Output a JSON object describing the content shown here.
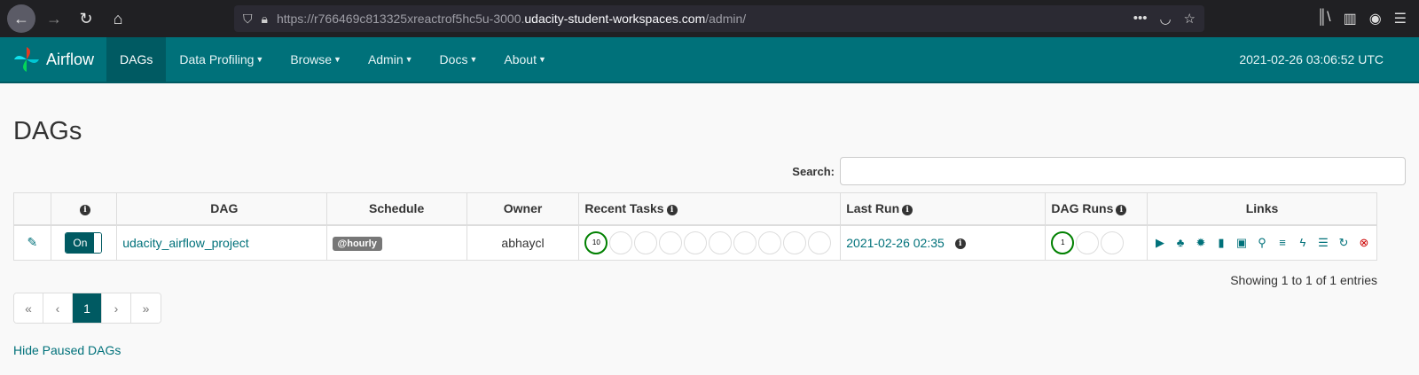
{
  "browser": {
    "url_prefix": "https://r766469c813325xreactrof5hc5u-3000.",
    "url_domain": "udacity-student-workspaces.com",
    "url_path": "/admin/"
  },
  "navbar": {
    "brand": "Airflow",
    "items": [
      {
        "label": "DAGs",
        "active": true,
        "dropdown": false
      },
      {
        "label": "Data Profiling",
        "dropdown": true
      },
      {
        "label": "Browse",
        "dropdown": true
      },
      {
        "label": "Admin",
        "dropdown": true
      },
      {
        "label": "Docs",
        "dropdown": true
      },
      {
        "label": "About",
        "dropdown": true
      }
    ],
    "time": "2021-02-26 03:06:52 UTC"
  },
  "page": {
    "title": "DAGs",
    "search_label": "Search:",
    "search_value": ""
  },
  "table": {
    "headers": [
      "",
      "DAG",
      "Schedule",
      "Owner",
      "Recent Tasks",
      "Last Run",
      "DAG Runs",
      "Links"
    ],
    "rows": [
      {
        "toggle": "On",
        "dag": "udacity_airflow_project",
        "schedule": "@hourly",
        "owner": "abhaycl",
        "recent_tasks_success": "10",
        "last_run": "2021-02-26 02:35",
        "dag_runs_success": "1"
      }
    ]
  },
  "footer": {
    "showing": "Showing 1 to 1 of 1 entries",
    "pager": [
      "«",
      "‹",
      "1",
      "›",
      "»"
    ],
    "hide_paused": "Hide Paused DAGs"
  },
  "colors": {
    "navbar": "#00717a",
    "navbar_active": "#005a62",
    "success": "#008000"
  }
}
